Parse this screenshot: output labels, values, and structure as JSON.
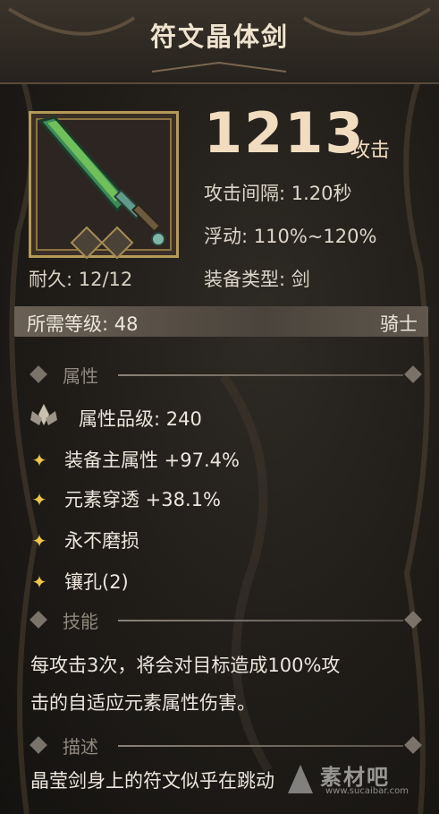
{
  "title": "符文晶体剑",
  "weapon": {
    "durability": "耐久: 12/12",
    "attack_value": "1213",
    "attack_label": "攻击",
    "interval": "攻击间隔: 1.20秒",
    "float": "浮动: 110%~120%",
    "type": "装备类型: 剑"
  },
  "requirement": {
    "level": "所需等级: 48",
    "class": "骑士"
  },
  "sections": {
    "attributes": "属性",
    "skill": "技能",
    "description": "描述"
  },
  "attributes": {
    "grade": "属性品级: 240",
    "items": [
      "装备主属性 +97.4%",
      "元素穿透 +38.1%",
      "永不磨损",
      "镶孔(2)"
    ]
  },
  "skill": {
    "line1": "每攻击3次，将会对目标造成100%攻",
    "line2": "击的自适应元素属性伤害。"
  },
  "description": {
    "text": "晶莹剑身上的符文似乎在跳动"
  },
  "watermark": {
    "text": "素材吧",
    "url": "www.sucaibar.com"
  },
  "colors": {
    "gold_frame": "#b59a58",
    "star": "#f0c64a",
    "attack_text": "#f1dcc0"
  },
  "icons": [
    "sword-icon",
    "star-icon",
    "lotus-grade-icon",
    "diamond-ornament-icon"
  ]
}
